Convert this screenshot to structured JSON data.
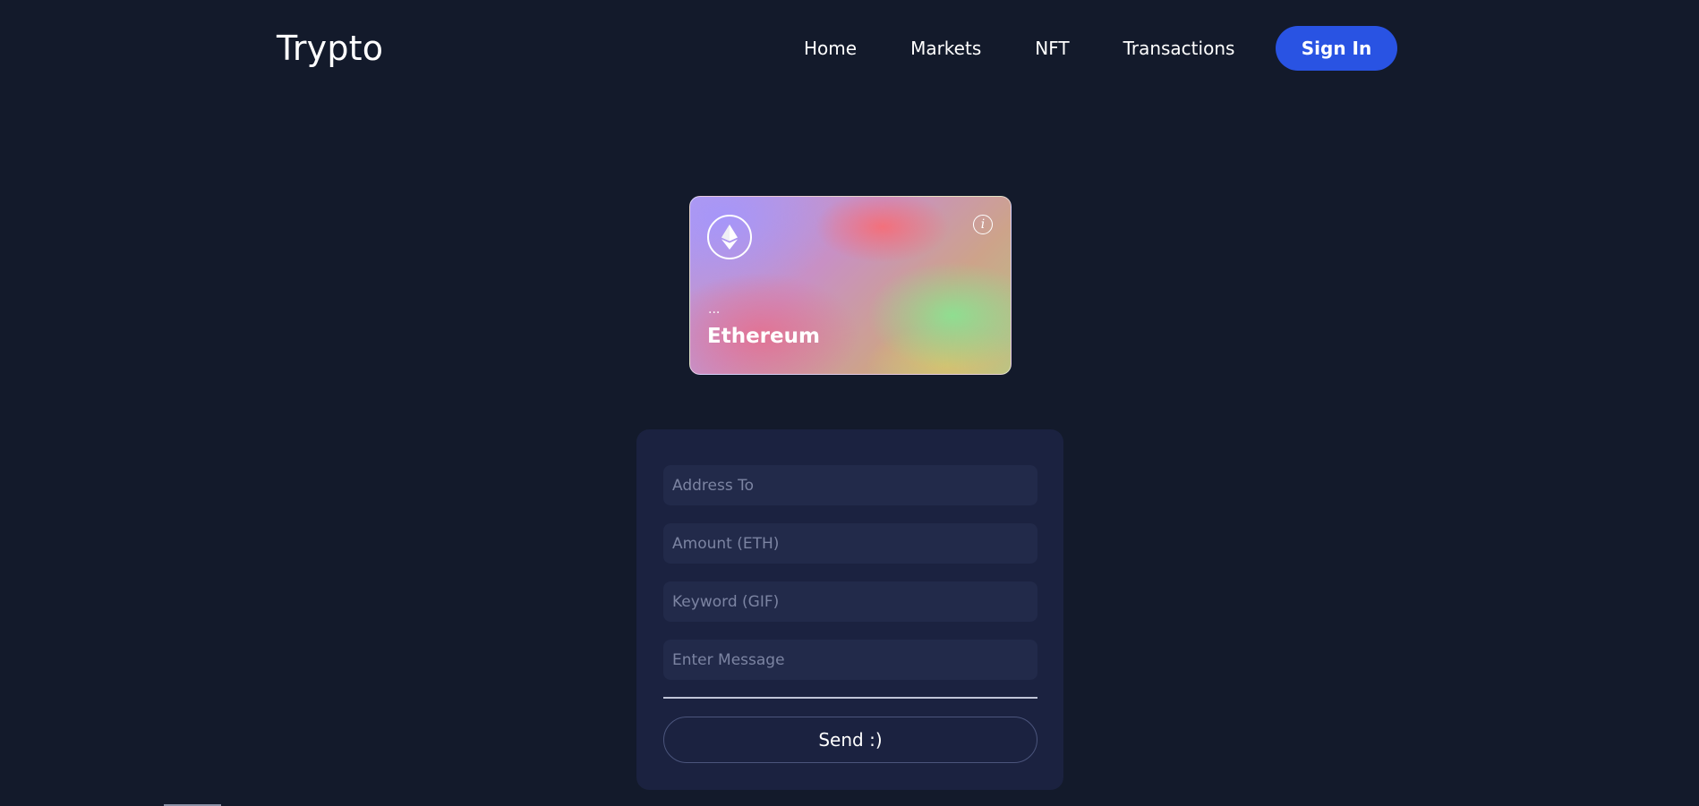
{
  "header": {
    "logo": "Trypto",
    "nav": [
      {
        "label": "Home"
      },
      {
        "label": "Markets"
      },
      {
        "label": "NFT"
      },
      {
        "label": "Transactions"
      }
    ],
    "sign_in_label": "Sign In"
  },
  "card": {
    "coin_icon": "ethereum-icon",
    "info_icon": "info-icon",
    "info_glyph": "i",
    "address": "...",
    "name": "Ethereum"
  },
  "form": {
    "address_placeholder": "Address To",
    "amount_placeholder": "Amount (ETH)",
    "keyword_placeholder": "Keyword (GIF)",
    "message_placeholder": "Enter Message",
    "send_label": "Send :)"
  },
  "colors": {
    "background": "#131a2b",
    "panel": "#1b2240",
    "field": "#222a4a",
    "accent": "#2953e3"
  }
}
